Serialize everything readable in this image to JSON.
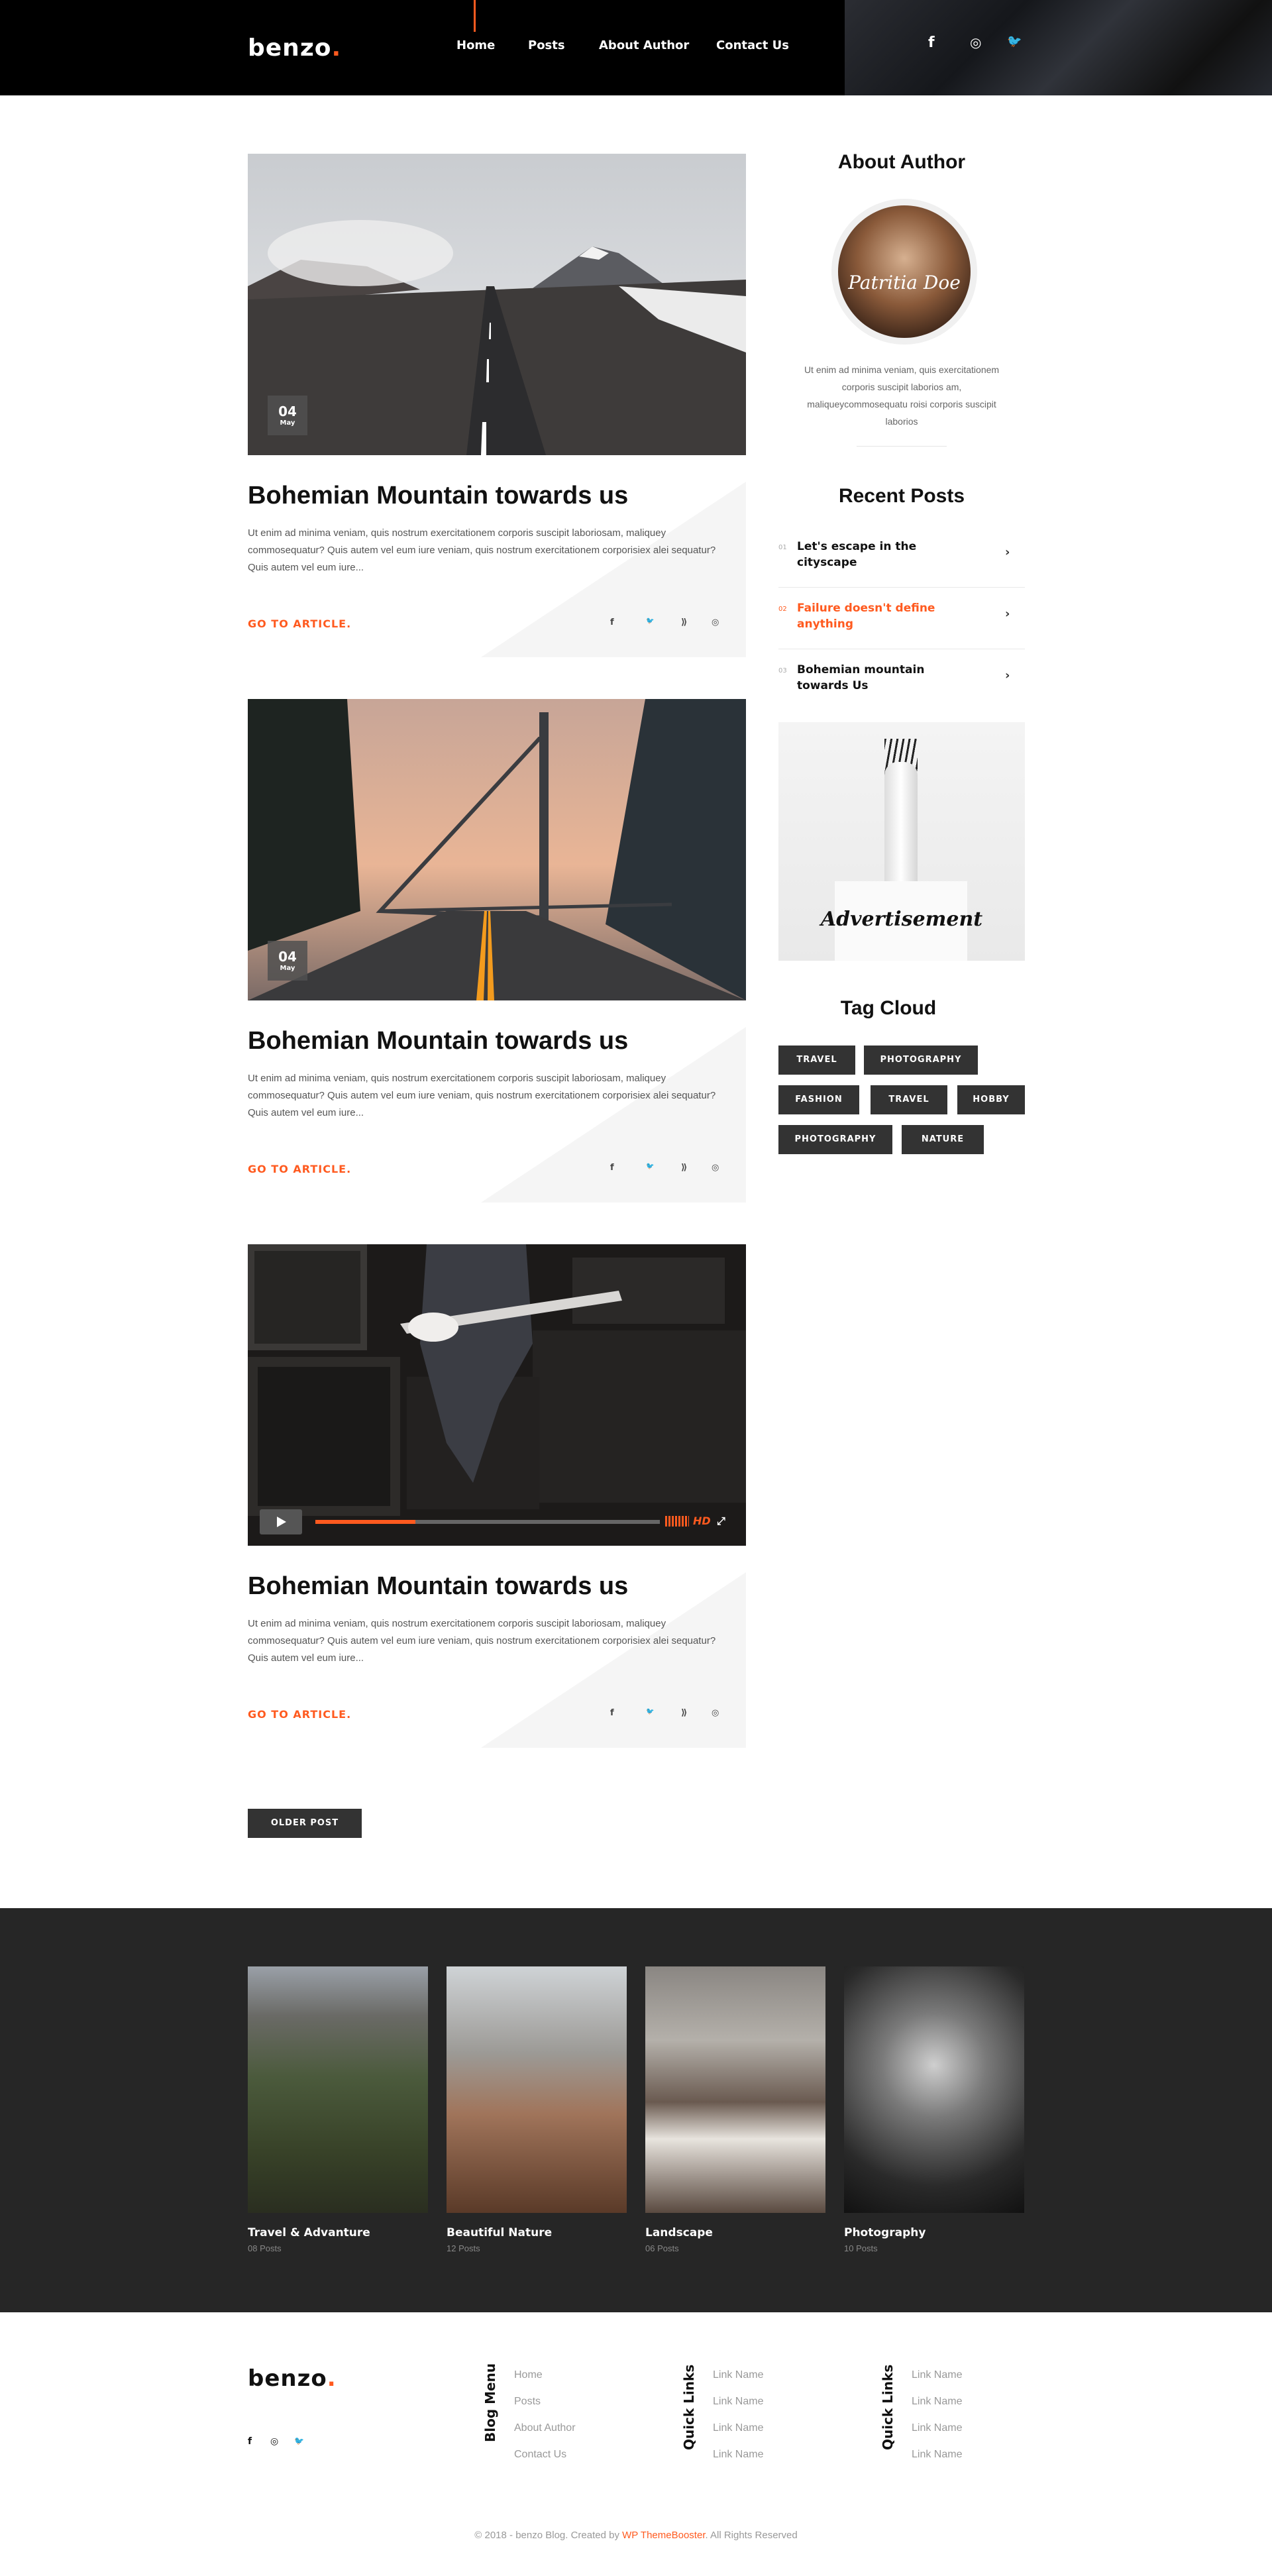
{
  "header": {
    "logo": "benzo",
    "logo_dot": ".",
    "nav": [
      "Home",
      "Posts",
      "About Author",
      "Contact Us"
    ],
    "social_icons": [
      "facebook-icon",
      "instagram-icon",
      "twitter-icon"
    ],
    "social_glyphs": [
      "f",
      "◎",
      "🐦"
    ]
  },
  "posts": [
    {
      "date_day": "04",
      "date_month": "May",
      "title": "Bohemian Mountain towards us",
      "excerpt": "Ut enim ad minima veniam, quis nostrum exercitationem corporis suscipit laboriosam, maliquey commosequatur? Quis autem vel eum iure veniam, quis nostrum exercitationem corporisiex alei sequatur? Quis autem vel eum iure...",
      "cta": "GO TO ARTICLE."
    },
    {
      "date_day": "04",
      "date_month": "May",
      "title": "Bohemian Mountain towards us",
      "excerpt": "Ut enim ad minima veniam, quis nostrum exercitationem corporis suscipit laboriosam, maliquey commosequatur? Quis autem vel eum iure veniam, quis nostrum exercitationem corporisiex alei sequatur? Quis autem vel eum iure...",
      "cta": "GO TO ARTICLE."
    },
    {
      "title": "Bohemian Mountain towards us",
      "excerpt": "Ut enim ad minima veniam, quis nostrum exercitationem corporis suscipit laboriosam, maliquey commosequatur? Quis autem vel eum iure veniam, quis nostrum exercitationem corporisiex alei sequatur? Quis autem vel eum iure...",
      "cta": "GO TO ARTICLE.",
      "video_quality": "HD",
      "video_progress": 0.29
    }
  ],
  "share_glyphs": [
    "f",
    "🐦",
    "⟫",
    "◎"
  ],
  "sidebar": {
    "about_title": "About Author",
    "author_signature": "Patritia Doe",
    "about_text": "Ut enim ad minima veniam, quis exercitationem corporis suscipit laborios am, maliqueycommosequatu roisi corporis suscipit laborios",
    "recent_title": "Recent Posts",
    "recent": [
      {
        "num": "01",
        "title": "Let's escape in the cityscape",
        "active": false
      },
      {
        "num": "02",
        "title": "Failure doesn't define anything",
        "active": true
      },
      {
        "num": "03",
        "title": "Bohemian mountain towards Us",
        "active": false
      }
    ],
    "ad_label": "Advertisement",
    "tag_title": "Tag Cloud",
    "tags": [
      "TRAVEL",
      "PHOTOGRAPHY",
      "FASHION",
      "TRAVEL",
      "HOBBY",
      "PHOTOGRAPHY",
      "NATURE"
    ]
  },
  "older_button": "OLDER POST",
  "categories": [
    {
      "name": "Travel & Advanture",
      "count": "08 Posts"
    },
    {
      "name": "Beautiful Nature",
      "count": "12 Posts"
    },
    {
      "name": "Landscape",
      "count": "06 Posts"
    },
    {
      "name": "Photography",
      "count": "10 Posts"
    }
  ],
  "footer": {
    "logo": "benzo",
    "logo_dot": ".",
    "social_glyphs": [
      "f",
      "◎",
      "🐦"
    ],
    "columns": [
      {
        "title": "Blog Menu",
        "links": [
          "Home",
          "Posts",
          "About Author",
          "Contact Us"
        ]
      },
      {
        "title": "Quick Links",
        "links": [
          "Link Name",
          "Link Name",
          "Link Name",
          "Link Name"
        ]
      },
      {
        "title": "Quick Links",
        "links": [
          "Link Name",
          "Link Name",
          "Link Name",
          "Link Name"
        ]
      }
    ],
    "copyright_pre": "© 2018 - benzo Blog. Created by ",
    "copyright_link": "WP ThemeBooster",
    "copyright_post": ". All Rights Reserved"
  },
  "colors": {
    "accent": "#ff5a1f",
    "dark": "#262626",
    "tag": "#333333"
  }
}
